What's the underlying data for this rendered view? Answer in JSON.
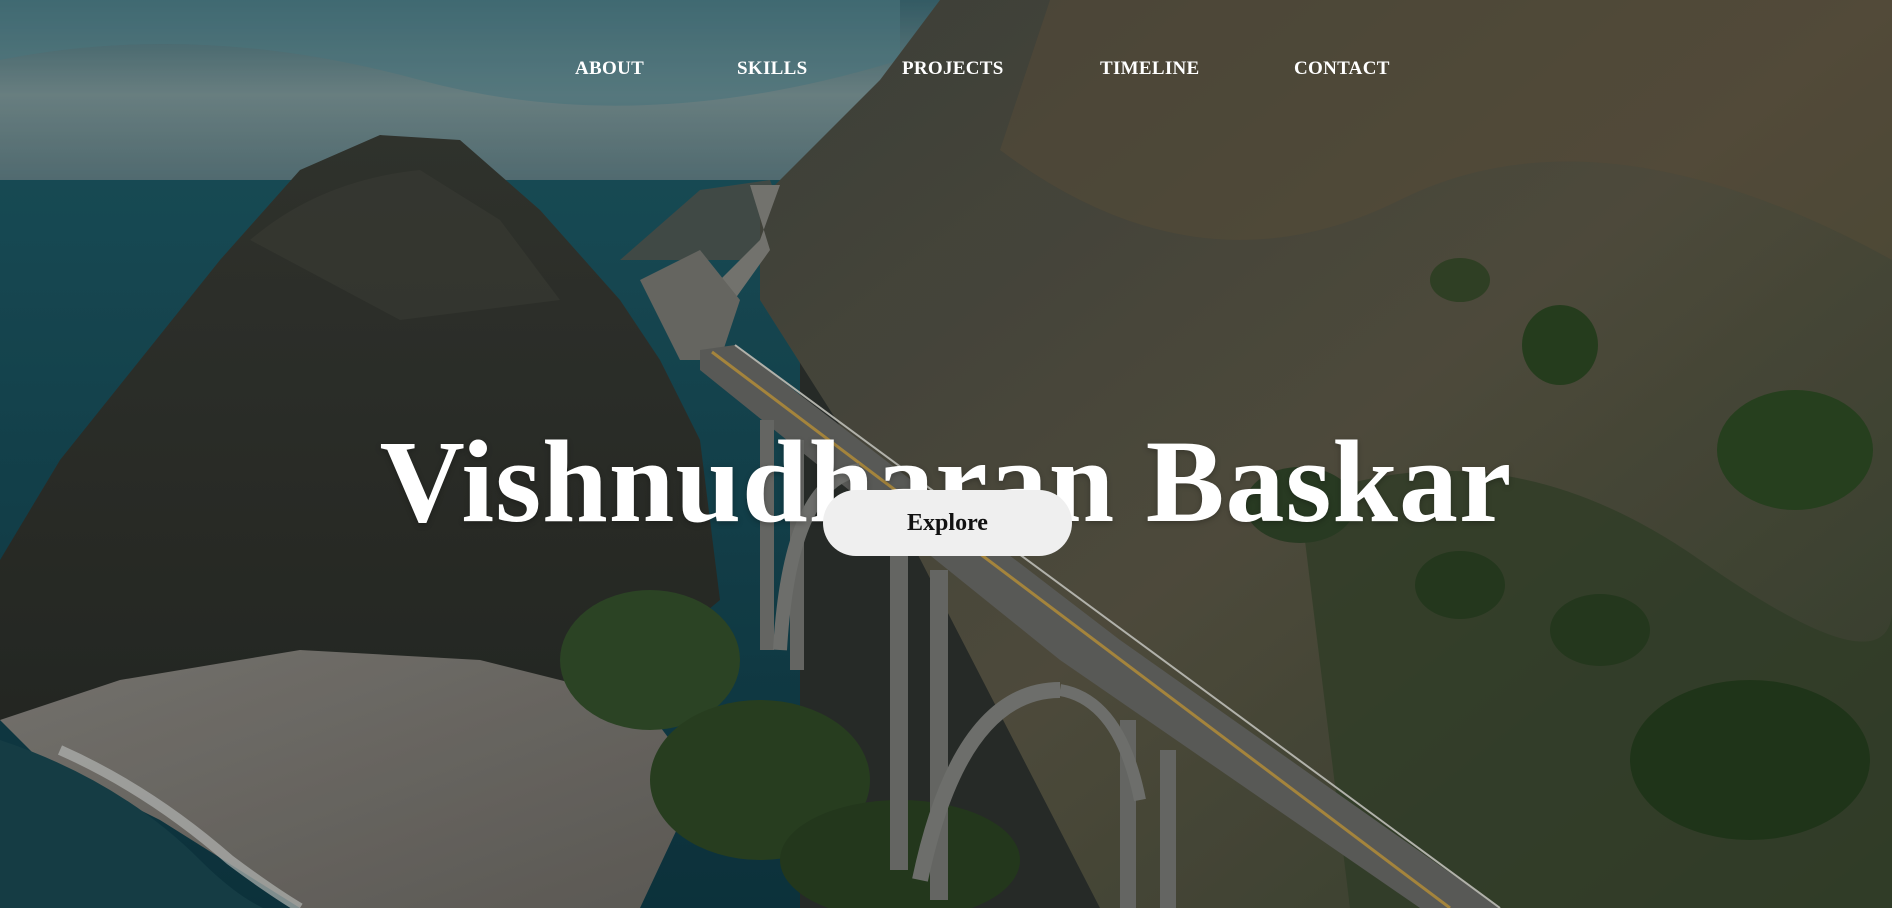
{
  "page": {
    "background_description_color": "#2f3430"
  },
  "nav": {
    "items": [
      {
        "label": "ABOUT"
      },
      {
        "label": "SKILLS"
      },
      {
        "label": "PROJECTS"
      },
      {
        "label": "TIMELINE"
      },
      {
        "label": "CONTACT"
      }
    ]
  },
  "hero": {
    "title": "Vishnudharan Baskar",
    "explore_label": "Explore"
  },
  "colors": {
    "text": "#ffffff",
    "button_bg": "#efefef",
    "button_text": "#111111"
  }
}
